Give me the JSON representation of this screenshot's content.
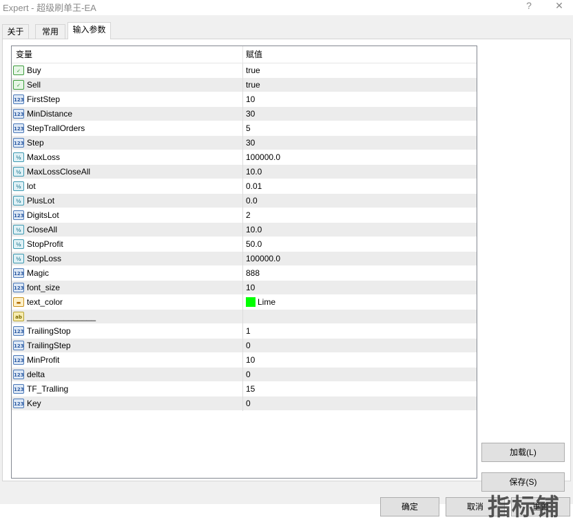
{
  "window": {
    "title": "Expert - 超级刷单王-EA",
    "help_glyph": "?",
    "close_glyph": "✕"
  },
  "tabs": [
    {
      "label": "关于"
    },
    {
      "label": "常用"
    },
    {
      "label": "输入参数",
      "active": true
    }
  ],
  "grid": {
    "col_variable": "变量",
    "col_value": "赋值",
    "rows": [
      {
        "name": "Buy",
        "value": "true",
        "type": "bool"
      },
      {
        "name": "Sell",
        "value": "true",
        "type": "bool"
      },
      {
        "name": "FirstStep",
        "value": "10",
        "type": "int"
      },
      {
        "name": "MinDistance",
        "value": "30",
        "type": "int"
      },
      {
        "name": "StepTrallOrders",
        "value": "5",
        "type": "int"
      },
      {
        "name": "Step",
        "value": "30",
        "type": "int"
      },
      {
        "name": "MaxLoss",
        "value": "100000.0",
        "type": "double"
      },
      {
        "name": "MaxLossCloseAll",
        "value": "10.0",
        "type": "double"
      },
      {
        "name": "lot",
        "value": "0.01",
        "type": "double"
      },
      {
        "name": "PlusLot",
        "value": "0.0",
        "type": "double"
      },
      {
        "name": "DigitsLot",
        "value": "2",
        "type": "int"
      },
      {
        "name": "CloseAll",
        "value": "10.0",
        "type": "double"
      },
      {
        "name": "StopProfit",
        "value": "50.0",
        "type": "double"
      },
      {
        "name": "StopLoss",
        "value": "100000.0",
        "type": "double"
      },
      {
        "name": "Magic",
        "value": "888",
        "type": "int"
      },
      {
        "name": "font_size",
        "value": "10",
        "type": "int"
      },
      {
        "name": "text_color",
        "value": "Lime",
        "type": "color",
        "color": "#00ff00"
      },
      {
        "name": "_______________",
        "value": "",
        "type": "string"
      },
      {
        "name": "TrailingStop",
        "value": "1",
        "type": "int"
      },
      {
        "name": "TrailingStep",
        "value": "0",
        "type": "int"
      },
      {
        "name": "MinProfit",
        "value": "10",
        "type": "int"
      },
      {
        "name": "delta",
        "value": "0",
        "type": "int"
      },
      {
        "name": "TF_Tralling",
        "value": "15",
        "type": "int"
      },
      {
        "name": "Key",
        "value": "0",
        "type": "int"
      }
    ]
  },
  "icons": {
    "bool": "✓",
    "int": "123",
    "double": "½",
    "color": "▬",
    "string": "ab"
  },
  "buttons": {
    "load": "加载(L)",
    "save": "保存(S)",
    "ok": "确定",
    "cancel": "取消",
    "reset": "重置"
  },
  "watermark": "指标铺"
}
